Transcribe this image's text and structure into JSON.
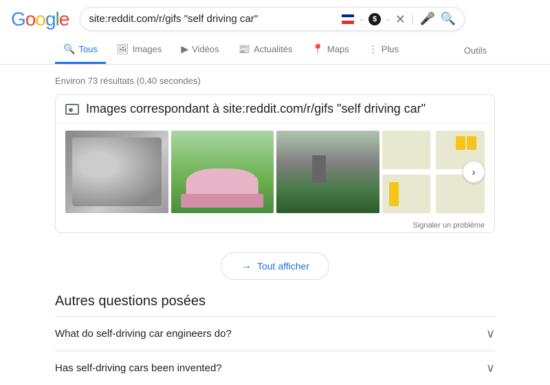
{
  "header": {
    "logo_letters": [
      "G",
      "o",
      "o",
      "g",
      "l",
      "e"
    ],
    "search_value": "site:reddit.com/r/gifs \"self driving car\""
  },
  "nav": {
    "tabs": [
      {
        "id": "tous",
        "label": "Tous",
        "icon": "🔍",
        "active": true
      },
      {
        "id": "images",
        "label": "Images",
        "icon": "🖼"
      },
      {
        "id": "videos",
        "label": "Vidéos",
        "icon": "▶"
      },
      {
        "id": "actualites",
        "label": "Actualités",
        "icon": "📰"
      },
      {
        "id": "maps",
        "label": "Maps",
        "icon": "📍"
      },
      {
        "id": "plus",
        "label": "Plus",
        "icon": "⋮"
      }
    ],
    "outils_label": "Outils"
  },
  "results": {
    "count_text": "Environ 73 résultats (0,40 secondes)",
    "image_section": {
      "header_text": "Images correspondant à site:reddit.com/r/gifs \"self driving car\"",
      "report_text": "Signaler un problème",
      "show_all_label": "Tout afficher"
    },
    "autres_questions": {
      "title": "Autres questions posées",
      "items": [
        {
          "text": "What do self-driving car engineers do?"
        },
        {
          "text": "Has self-driving cars been invented?"
        }
      ]
    }
  }
}
